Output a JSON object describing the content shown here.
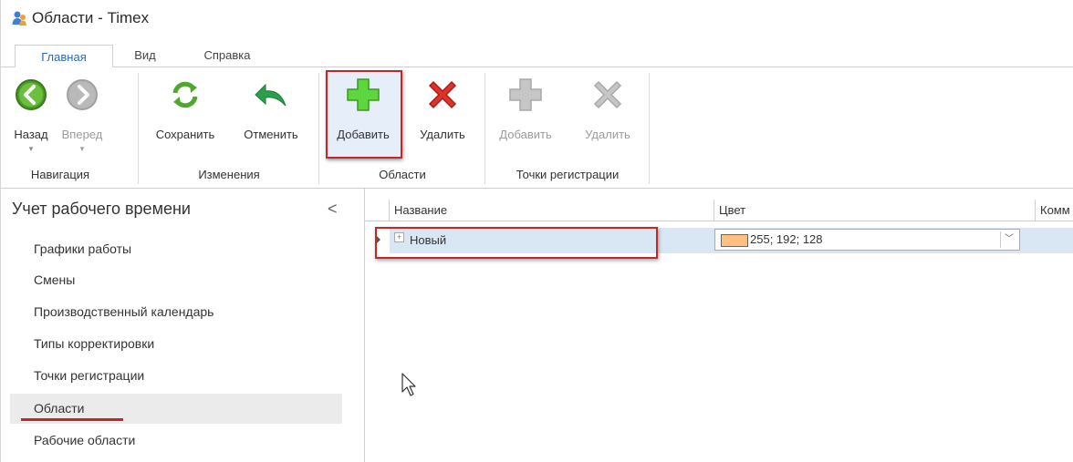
{
  "window": {
    "title": "Области - Timex"
  },
  "tabs": [
    {
      "label": "Главная"
    },
    {
      "label": "Вид"
    },
    {
      "label": "Справка"
    }
  ],
  "ribbon": {
    "back": "Назад",
    "forward": "Вперед",
    "save": "Сохранить",
    "cancel": "Отменить",
    "add_area": "Добавить",
    "delete_area": "Удалить",
    "add_point": "Добавить",
    "delete_point": "Удалить",
    "groups": {
      "navigation": "Навигация",
      "changes": "Изменения",
      "areas": "Области",
      "points": "Точки регистрации"
    }
  },
  "sidebar": {
    "header": "Учет рабочего времени",
    "collapse": "<",
    "items": [
      {
        "label": "Графики работы"
      },
      {
        "label": "Смены"
      },
      {
        "label": "Производственный календарь"
      },
      {
        "label": "Типы корректировки"
      },
      {
        "label": "Точки регистрации"
      },
      {
        "label": "Области"
      },
      {
        "label": "Рабочие области"
      }
    ]
  },
  "grid": {
    "columns": [
      "Название",
      "Цвет",
      "Комм"
    ],
    "rows": [
      {
        "name": "Новый",
        "color_value": "255; 192; 128",
        "swatch": "#ffc080"
      }
    ]
  },
  "colors": {
    "accent": "#2a6bb5",
    "highlight": "#c0282a",
    "row_selected": "#d9e7f5"
  }
}
